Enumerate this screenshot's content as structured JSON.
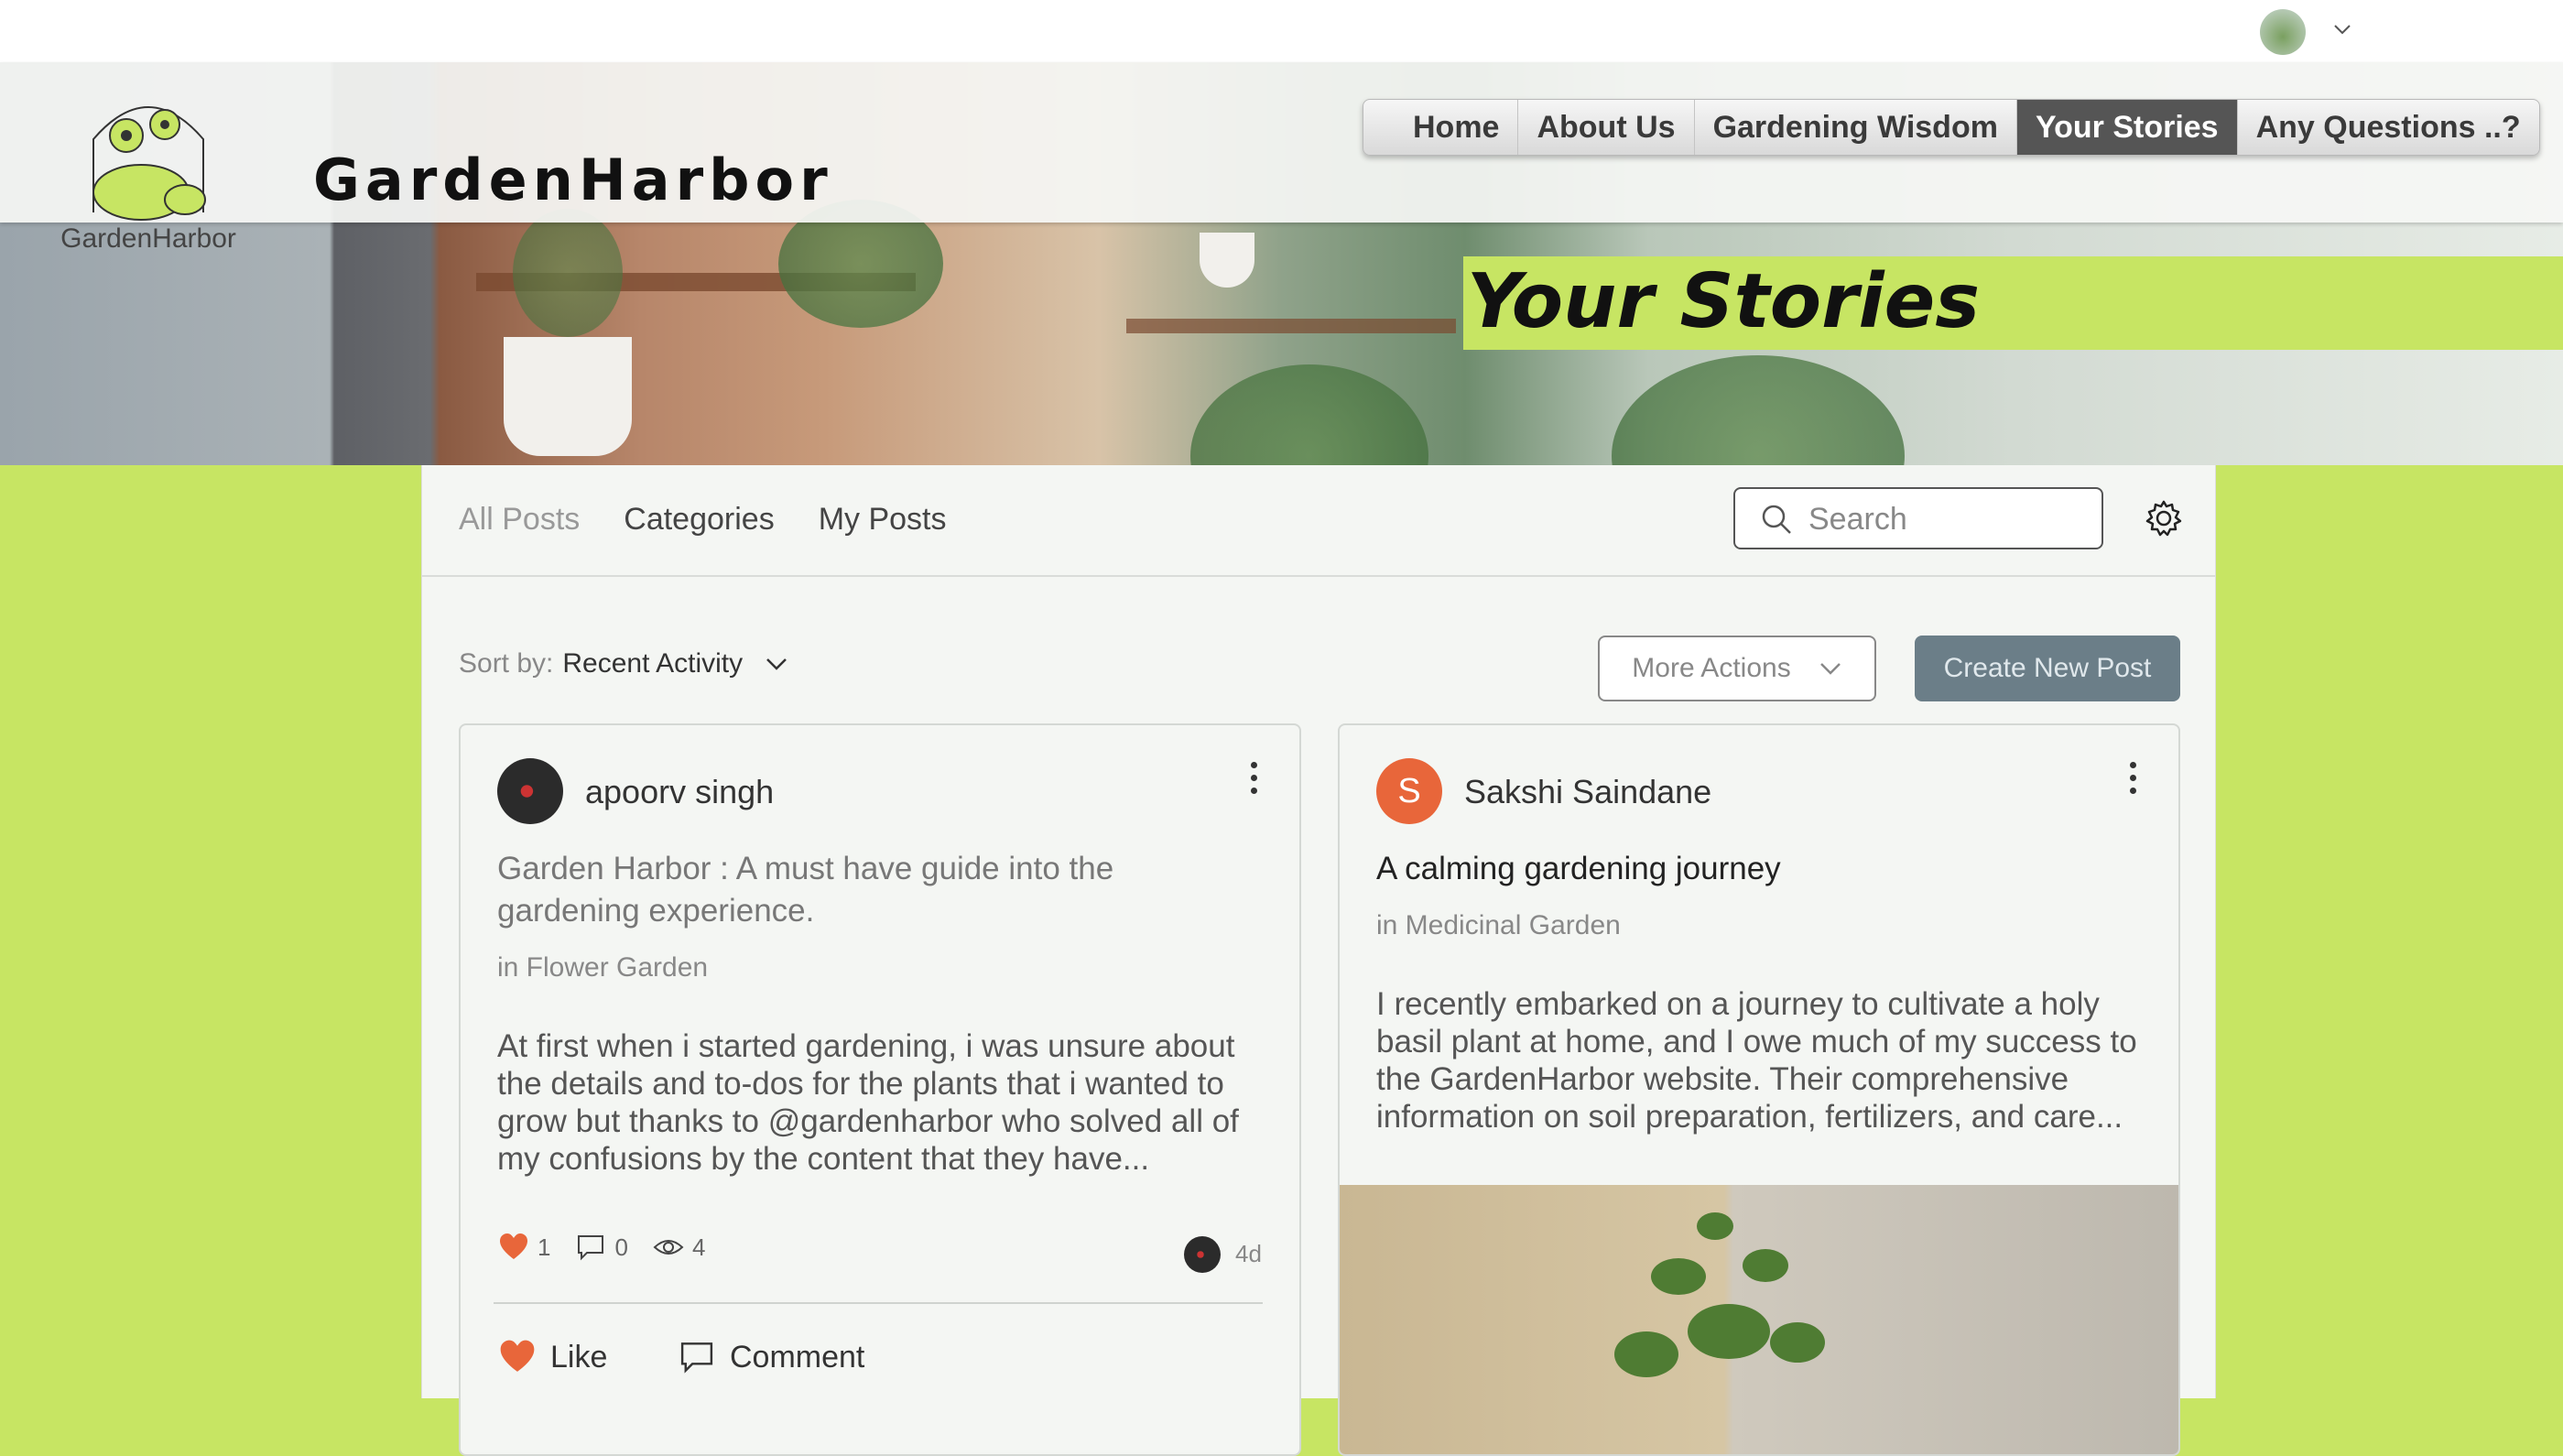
{
  "site": {
    "brand": "GardenHarbor",
    "logo_text": "GardenHarbor"
  },
  "nav": {
    "items": [
      {
        "label": "Home",
        "active": false
      },
      {
        "label": "About Us",
        "active": false
      },
      {
        "label": "Gardening Wisdom",
        "active": false
      },
      {
        "label": "Your Stories",
        "active": true
      },
      {
        "label": "Any Questions ..?",
        "active": false
      }
    ]
  },
  "banner": {
    "title": "Your Stories"
  },
  "user_menu": {
    "icon": "chevron-down-icon"
  },
  "forum": {
    "tabs": [
      {
        "label": "All Posts",
        "active": true
      },
      {
        "label": "Categories",
        "active": false
      },
      {
        "label": "My Posts",
        "active": false
      }
    ],
    "search": {
      "placeholder": "Search",
      "value": ""
    },
    "sort": {
      "label": "Sort by:",
      "value": "Recent Activity"
    },
    "more_actions_label": "More Actions",
    "create_post_label": "Create New Post",
    "posts": [
      {
        "author": "apoorv singh",
        "title": "Garden Harbor : A must have guide into the gardening experience.",
        "category": "in Flower Garden",
        "excerpt": "At first when i started gardening, i was unsure about the details and to-dos for the plants that i wanted to grow but thanks to @gardenharbor who solved all of my confusions by the content that they have...",
        "likes": "1",
        "comments": "0",
        "views": "4",
        "age": "4d",
        "like_label": "Like",
        "comment_label": "Comment"
      },
      {
        "author": "Sakshi Saindane",
        "avatar_initial": "S",
        "title": "A calming gardening journey",
        "category": "in Medicinal Garden",
        "excerpt": "I recently embarked on a journey to cultivate a holy basil plant at home, and I owe much of my success to the GardenHarbor website. Their comprehensive information on soil preparation, fertilizers, and care..."
      }
    ]
  },
  "colors": {
    "lime_background": "#c7e563",
    "active_nav": "#555555",
    "create_button": "#6b7e88",
    "like_heart": "#e8663a"
  }
}
